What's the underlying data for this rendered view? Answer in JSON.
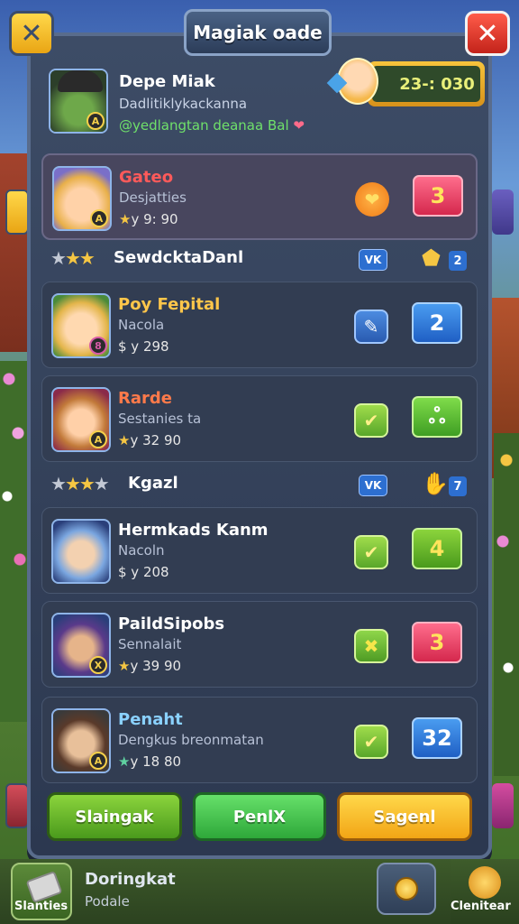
{
  "window": {
    "title": "Magiak oade"
  },
  "top_bar": {
    "close_left_icon": "x-icon",
    "close_right_icon": "x-icon"
  },
  "profile": {
    "name": "Depe Miak",
    "subtitle": "Dadlitiklykackanna",
    "status": "@yedlangtan deanaa Bal",
    "score": "23-: 030",
    "badge": "A"
  },
  "rows": [
    {
      "name": "Gateo",
      "name_color": "#ff5a5a",
      "sub": "Desjatties",
      "value": "y 9: 90",
      "star": "★",
      "badge": "A",
      "action_icon": "heart-icon",
      "action_glyph": "❤",
      "number": "3",
      "num_style": "red"
    },
    {
      "name": "Poy Fepital",
      "name_color": "#ffc64a",
      "sub": "Nacola",
      "value": "$ y 298",
      "star": "",
      "badge": "8",
      "action_icon": "pencil-icon",
      "action_glyph": "✎",
      "number": "2",
      "num_style": "blue"
    },
    {
      "name": "Rarde",
      "name_color": "#ff7a4a",
      "sub": "Sestanies ta",
      "value": "y 32 90",
      "star": "★",
      "badge": "A",
      "action_icon": "check-icon",
      "action_glyph": "✔",
      "number": "ஃ",
      "num_style": "green"
    },
    {
      "name": "Hermkads Kanm",
      "name_color": "#ffffff",
      "sub": "Nacoln",
      "value": "$ y 208",
      "star": "",
      "badge": "",
      "action_icon": "check-icon",
      "action_glyph": "✔",
      "number": "4",
      "num_style": "green-y"
    },
    {
      "name": "PaildSipobs",
      "name_color": "#ffffff",
      "sub": "Sennalait",
      "value": "y 39 90",
      "star": "★",
      "badge": "X",
      "action_icon": "cross-icon",
      "action_glyph": "✖",
      "number": "3",
      "num_style": "red"
    },
    {
      "name": "Penaht",
      "name_color": "#8ad1ff",
      "sub": "Dengkus breonmatan",
      "value": "y 18 80",
      "star": "★",
      "badge": "A",
      "action_icon": "check-icon",
      "action_glyph": "✔",
      "number": "32",
      "num_style": "blue"
    }
  ],
  "sections": [
    {
      "title": "SewdcktaDanl",
      "vk": "VK",
      "icon": "shield-icon",
      "icon_glyph": "🛡",
      "num": "2"
    },
    {
      "title": "Kgazl",
      "vk": "VK",
      "icon": "hand-icon",
      "icon_glyph": "✋",
      "num": "7"
    }
  ],
  "footer": {
    "btn1": "Slaingak",
    "btn2": "PenlX",
    "btn3": "Sagenl"
  },
  "bottom": {
    "left_label": "Slanties",
    "title": "Doringkat",
    "subtitle": "Podale",
    "right_label": "Clenitear"
  }
}
